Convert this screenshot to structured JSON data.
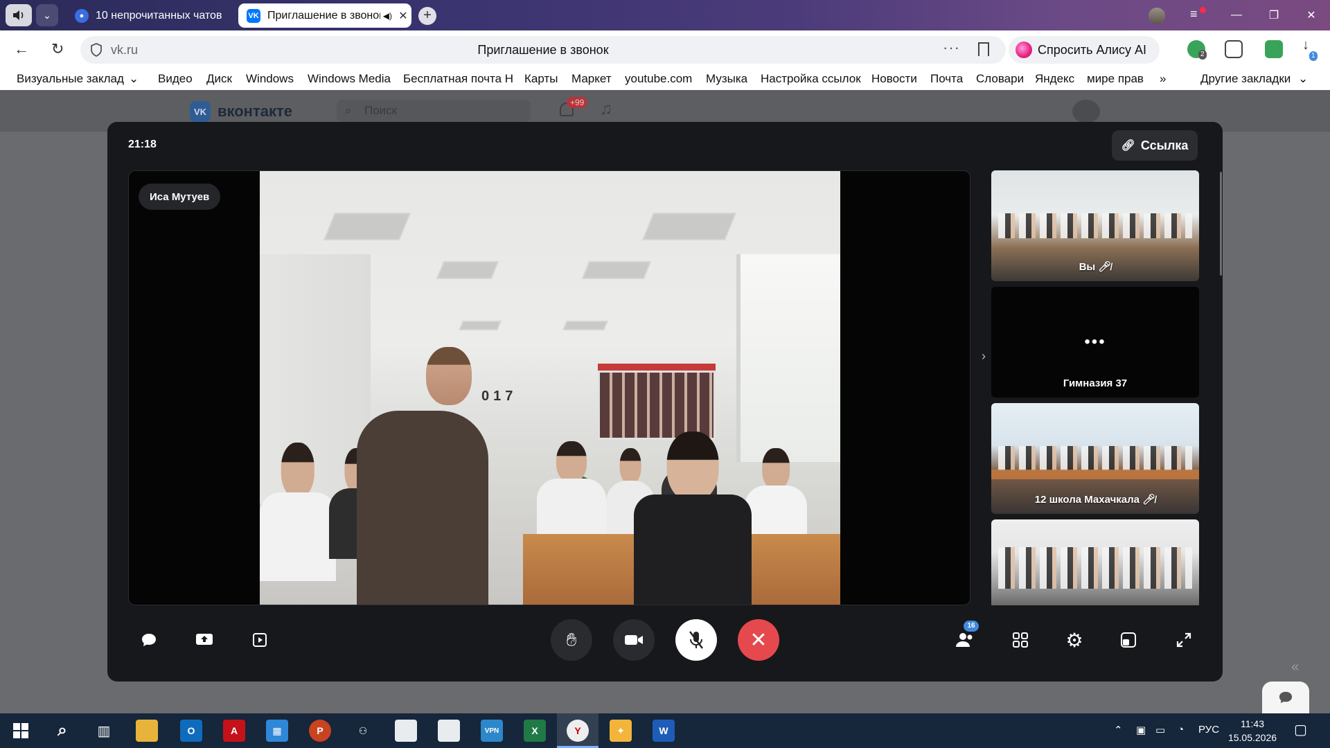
{
  "browser": {
    "tabs": [
      {
        "title": "10 непрочитанных чатов",
        "active": false
      },
      {
        "title": "Приглашение в звонок",
        "active": true
      }
    ],
    "address": {
      "domain": "vk.ru",
      "page_title": "Приглашение в звонок"
    },
    "alice_button": "Спросить Алису AI",
    "bookmarks": [
      "Визуальные заклад",
      "Видео",
      "Диск",
      "Windows",
      "Windows Media",
      "Бесплатная почта Н",
      "Карты",
      "Маркет",
      "youtube.com",
      "Музыка",
      "Настройка ссылок",
      "Новости",
      "Почта",
      "Словари",
      "Яндекс",
      "мире прав"
    ],
    "bookmarks_more": "»",
    "other_bookmarks": "Другие закладки",
    "ext_badges": [
      "2",
      "1"
    ]
  },
  "vk": {
    "logo": "вконтакте",
    "search_placeholder": "Поиск",
    "notif_badge": "+99"
  },
  "call": {
    "timer": "21:18",
    "link_button": "Ссылка",
    "speaker_name": "Иса Мутуев",
    "board_text": "017",
    "participants": [
      {
        "label": "Вы",
        "muted": true
      },
      {
        "label": "Гимназия 37",
        "muted": false
      },
      {
        "label": "12 школа Махачкала",
        "muted": true
      },
      {
        "label": "",
        "muted": false
      }
    ],
    "thumb_dots": "•••",
    "participants_count": "16"
  },
  "taskbar": {
    "lang": "РУС",
    "time": "11:43",
    "date": "15.05.2026"
  },
  "colors": {
    "end_call": "#e5484d",
    "accent": "#3f8ae0",
    "taskbar": "#16263b"
  }
}
